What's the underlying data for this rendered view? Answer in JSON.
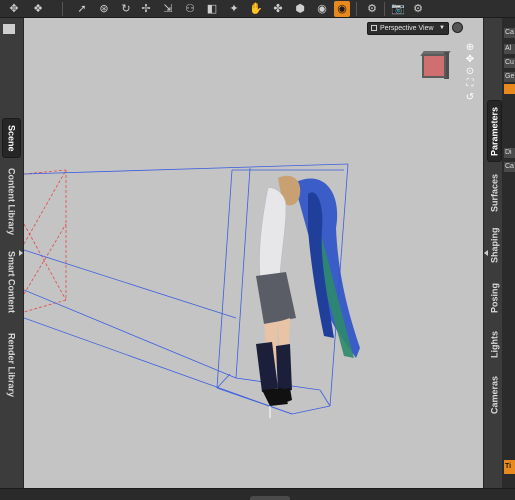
{
  "app": {
    "accent_color": "#e8891e",
    "viewport_background": "#c4c4c4"
  },
  "toolbar": {
    "tools": [
      {
        "name": "universal-tool-icon",
        "glyph": "✥"
      },
      {
        "name": "scene-tool-icon",
        "glyph": "❖"
      },
      {
        "name": "pointer-tool-icon",
        "glyph": "➚"
      },
      {
        "name": "node-weight-tool-icon",
        "glyph": "⊛"
      },
      {
        "name": "rotate-tool-icon",
        "glyph": "↻"
      },
      {
        "name": "translate-tool-icon",
        "glyph": "✢"
      },
      {
        "name": "scale-tool-icon",
        "glyph": "⇲"
      },
      {
        "name": "joint-editor-tool-icon",
        "glyph": "⚇"
      },
      {
        "name": "surface-selection-tool-icon",
        "glyph": "◧"
      },
      {
        "name": "geometry-editor-tool-icon",
        "glyph": "✦"
      },
      {
        "name": "active-pose-tool-icon",
        "glyph": "✋"
      },
      {
        "name": "power-pose-tool-icon",
        "glyph": "✤"
      },
      {
        "name": "region-navigator-tool-icon",
        "glyph": "⬢"
      },
      {
        "name": "camera-view-tool-icon",
        "glyph": "◉"
      },
      {
        "name": "render-settings-icon",
        "glyph": "⚙"
      },
      {
        "name": "render-icon",
        "glyph": "📷"
      },
      {
        "name": "render-library-icon",
        "glyph": "⚙"
      }
    ]
  },
  "left_pane": {
    "tabs": [
      {
        "label": "Scene"
      },
      {
        "label": "Content Library"
      },
      {
        "label": "Smart Content"
      },
      {
        "label": "Render Library"
      }
    ]
  },
  "right_pane": {
    "tabs": [
      {
        "label": "Parameters"
      },
      {
        "label": "Surfaces"
      },
      {
        "label": "Shaping"
      },
      {
        "label": "Posing"
      },
      {
        "label": "Lights"
      },
      {
        "label": "Cameras"
      }
    ],
    "strip_labels": [
      "Ca",
      "Al",
      "Cu",
      "Ge",
      "Di",
      "Ca"
    ],
    "orange_label": "Ti"
  },
  "viewport": {
    "view_label": "Perspective View",
    "controls": [
      {
        "name": "orbit-control-icon",
        "glyph": "⊕"
      },
      {
        "name": "pan-control-icon",
        "glyph": "✥"
      },
      {
        "name": "zoom-control-icon",
        "glyph": "⊙"
      },
      {
        "name": "frame-control-icon",
        "glyph": "⛶"
      },
      {
        "name": "reset-view-icon",
        "glyph": "↺"
      }
    ]
  }
}
